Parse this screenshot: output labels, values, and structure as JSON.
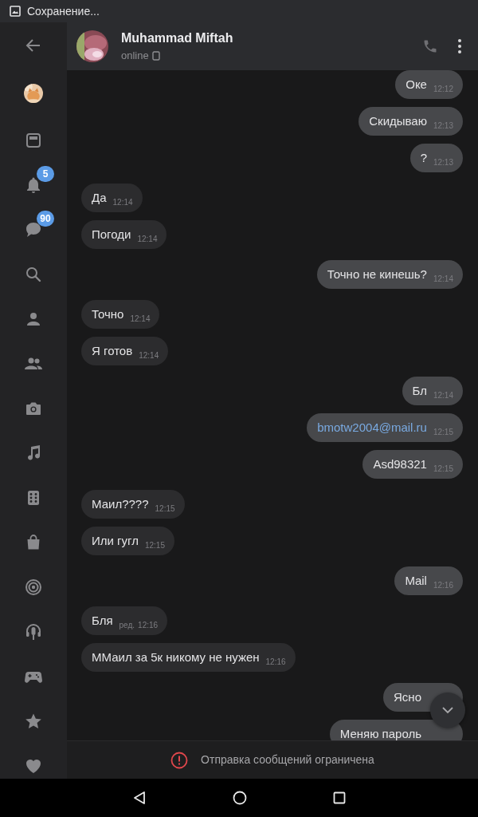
{
  "status_bar": {
    "text": "Сохранение..."
  },
  "sidebar": {
    "items": [
      {
        "kind": "panel"
      },
      {
        "kind": "bell",
        "badge": "5"
      },
      {
        "kind": "chat",
        "badge": "90"
      },
      {
        "kind": "search"
      },
      {
        "kind": "person"
      },
      {
        "kind": "people"
      },
      {
        "kind": "camera"
      },
      {
        "kind": "music"
      },
      {
        "kind": "dice"
      },
      {
        "kind": "bag"
      },
      {
        "kind": "target"
      },
      {
        "kind": "microphone"
      },
      {
        "kind": "gamepad"
      },
      {
        "kind": "star"
      },
      {
        "kind": "heart"
      }
    ]
  },
  "header": {
    "name": "Muhammad Miftah",
    "status": "online"
  },
  "messages": [
    {
      "outgoing": true,
      "kind": "text",
      "text": "Оке",
      "time": "12:12"
    },
    {
      "outgoing": true,
      "kind": "text",
      "text": "Скидываю",
      "time": "12:13"
    },
    {
      "outgoing": true,
      "kind": "text",
      "text": "?",
      "time": "12:13"
    },
    {
      "outgoing": false,
      "kind": "text",
      "text": "Да",
      "time": "12:14"
    },
    {
      "outgoing": false,
      "kind": "text",
      "text": "Погоди",
      "time": "12:14"
    },
    {
      "outgoing": true,
      "kind": "text",
      "text": "Точно не кинешь?",
      "time": "12:14"
    },
    {
      "outgoing": false,
      "kind": "text",
      "text": "Точно",
      "time": "12:14"
    },
    {
      "outgoing": false,
      "kind": "text",
      "text": "Я готов",
      "time": "12:14"
    },
    {
      "outgoing": true,
      "kind": "text",
      "text": "Бл",
      "time": "12:14"
    },
    {
      "outgoing": true,
      "kind": "link",
      "text": "bmotw2004@mail.ru",
      "time": "12:15"
    },
    {
      "outgoing": true,
      "kind": "text",
      "text": "Asd98321",
      "time": "12:15"
    },
    {
      "outgoing": false,
      "kind": "text",
      "text": "Маил????",
      "time": "12:15"
    },
    {
      "outgoing": false,
      "kind": "text",
      "text": "Или гугл",
      "time": "12:15"
    },
    {
      "outgoing": true,
      "kind": "text",
      "text": "Mail",
      "time": "12:16"
    },
    {
      "outgoing": false,
      "kind": "text",
      "text": "Бля",
      "edited": "ред.",
      "time": "12:16"
    },
    {
      "outgoing": false,
      "kind": "text",
      "text": "ММаил за 5к никому не нужен",
      "time": "12:16"
    },
    {
      "outgoing": true,
      "kind": "text",
      "text": "Ясно"
    },
    {
      "outgoing": true,
      "kind": "text",
      "text": "Меняю пароль"
    }
  ],
  "footer": {
    "notice": "Отправка сообщений ограничена"
  }
}
